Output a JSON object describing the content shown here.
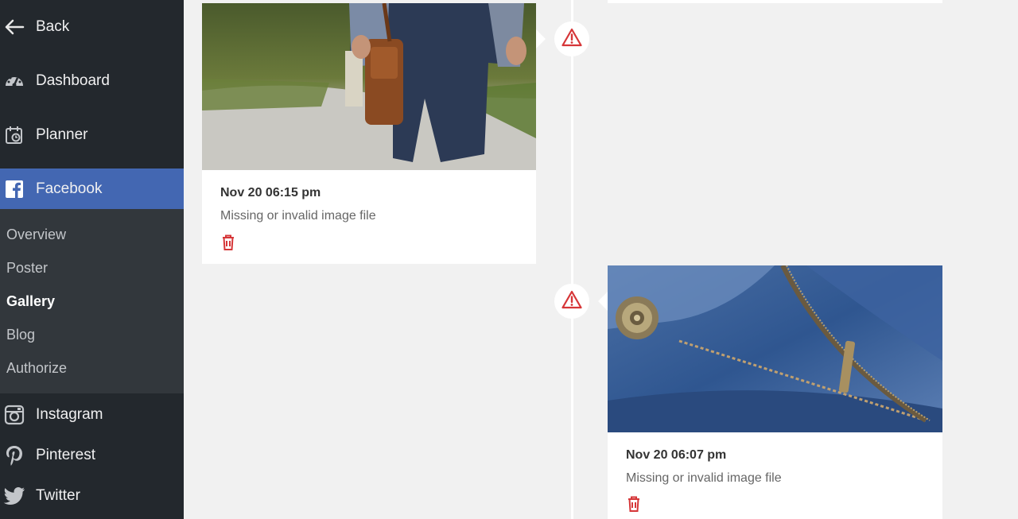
{
  "sidebar": {
    "back": {
      "label": "Back",
      "icon": "arrow-left-icon"
    },
    "dashboard": {
      "label": "Dashboard",
      "icon": "dashboard-icon"
    },
    "planner": {
      "label": "Planner",
      "icon": "calendar-icon"
    },
    "facebook": {
      "label": "Facebook",
      "icon": "facebook-icon"
    },
    "facebook_submenu": [
      {
        "label": "Overview"
      },
      {
        "label": "Poster"
      },
      {
        "label": "Gallery"
      },
      {
        "label": "Blog"
      },
      {
        "label": "Authorize"
      }
    ],
    "instagram": {
      "label": "Instagram",
      "icon": "instagram-icon"
    },
    "pinterest": {
      "label": "Pinterest",
      "icon": "pinterest-icon"
    },
    "twitter": {
      "label": "Twitter",
      "icon": "twitter-icon"
    }
  },
  "timeline": [
    {
      "date": "Nov 20 06:15 pm",
      "status": "Missing or invalid image file",
      "image": "man-walking-with-bag-photo"
    },
    {
      "date": "Nov 20 06:07 pm",
      "status": "Missing or invalid image file",
      "image": "jeans-zipper-photo"
    }
  ],
  "colors": {
    "accent": "#4367b2",
    "sidebar": "#23282d",
    "submenu": "#32373c",
    "warning": "#d63638"
  }
}
